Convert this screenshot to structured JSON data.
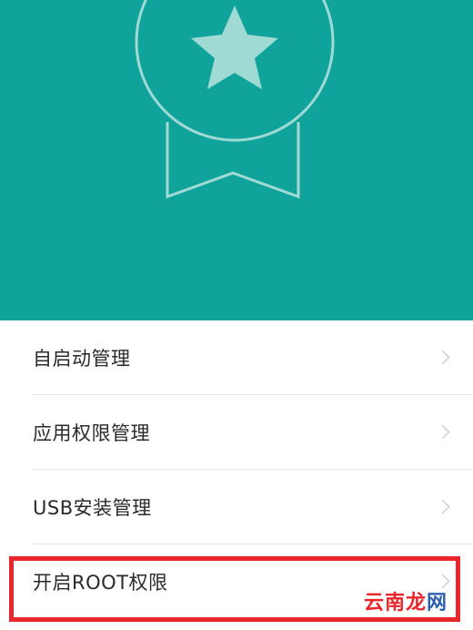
{
  "menu": {
    "items": [
      {
        "label": "自启动管理"
      },
      {
        "label": "应用权限管理"
      },
      {
        "label": "USB安装管理"
      },
      {
        "label": "开启ROOT权限"
      }
    ]
  },
  "watermark": {
    "text": "云南龙网",
    "chars": [
      "云",
      "南",
      "龙",
      "网"
    ]
  },
  "colors": {
    "hero_bg": "#0fa39b",
    "highlight_border": "#e8262b",
    "watermark_red": "#e8262b",
    "watermark_blue": "#2c5fb0"
  },
  "icons": {
    "hero": "medal-star-icon",
    "chevron": "chevron-right-icon"
  }
}
